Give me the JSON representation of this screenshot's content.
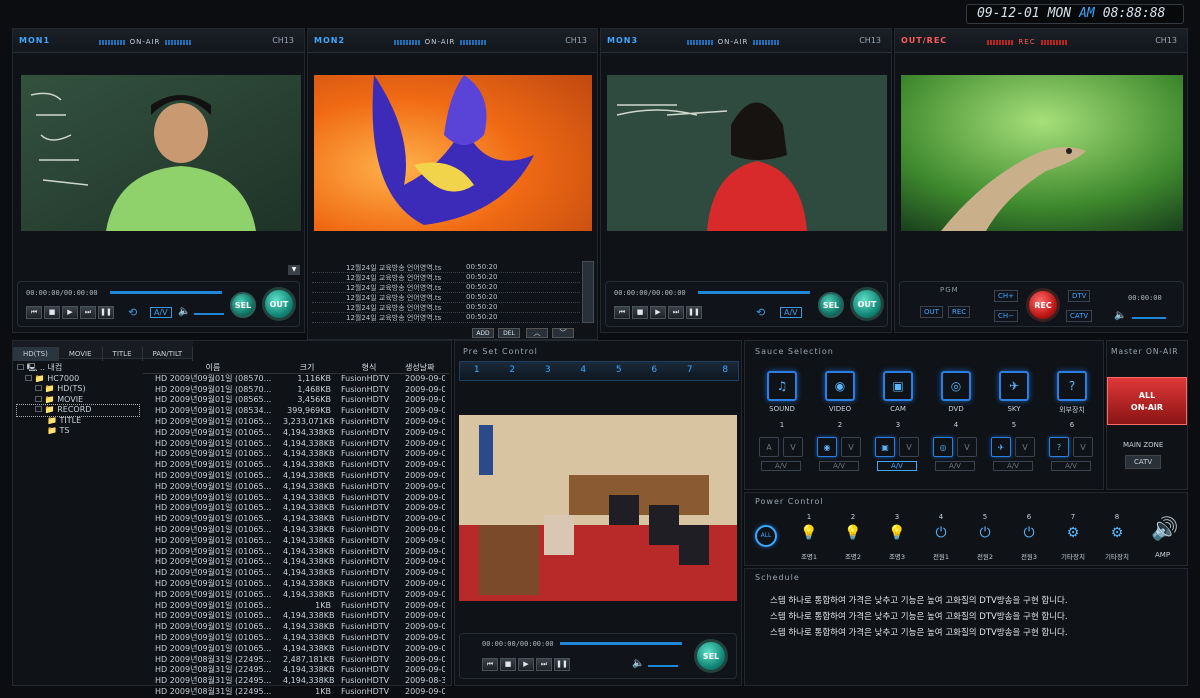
{
  "clock": {
    "date": "09-12-01",
    "day": "MON",
    "ampm": "AM",
    "time": "08:88:88"
  },
  "monitors": [
    {
      "name": "MON1",
      "status": "ON-AIR",
      "channel": "CH13",
      "timecode": "00:00:00/00:00:00",
      "name_color": "#3ea7ff"
    },
    {
      "name": "MON2",
      "status": "ON-AIR",
      "channel": "CH13",
      "name_color": "#3ea7ff"
    },
    {
      "name": "MON3",
      "status": "ON-AIR",
      "channel": "CH13",
      "timecode": "00:00:00/00:00:00",
      "name_color": "#3ea7ff"
    },
    {
      "name": "OUT/REC",
      "status": "REC",
      "channel": "CH13",
      "name_color": "#ff5a5a"
    }
  ],
  "playlist": {
    "items": [
      {
        "name": "12월24일 교육방송 언어영역.ts",
        "time": "00:50:20"
      },
      {
        "name": "12월24일 교육방송 언어영역.ts",
        "time": "00:50:20"
      },
      {
        "name": "12월24일 교육방송 언어영역.ts",
        "time": "00:50:20"
      },
      {
        "name": "12월24일 교육방송 언어영역.ts",
        "time": "00:50:20"
      },
      {
        "name": "12월24일 교육방송 언어영역.ts",
        "time": "00:50:20"
      },
      {
        "name": "12월24일 교육방송 언어영역.ts",
        "time": "00:50:20"
      }
    ],
    "add_label": "ADD",
    "del_label": "DEL"
  },
  "controls": {
    "av_label": "A/V",
    "sel_label": "SEL",
    "out_label": "OUT"
  },
  "outrec": {
    "pgm_label": "PGM",
    "out_label": "OUT",
    "rec_label": "REC",
    "chplus": "CH+",
    "chminus": "CH−",
    "dtv": "DTV",
    "catv": "CATV",
    "rec_btn": "REC",
    "timecode": "00:00:00"
  },
  "browser": {
    "tabs": [
      "HD(TS)",
      "MOVIE",
      "TITLE",
      "PAN/TILT"
    ],
    "tree": [
      "☐ 🖳 .. 내컴",
      "☐ 📁 HC7000",
      "☐ 📁 HD(TS)",
      "☐ 📁 MOVIE",
      "☐ 📁 RECORD",
      "📁 TITLE",
      "📁 TS"
    ],
    "columns": [
      "이름",
      "크기",
      "형식",
      "생성날짜"
    ],
    "rows": [
      [
        "HD 2009년09월01일 (08570...",
        "1,116KB",
        "FusionHDTV",
        "2009-09-01"
      ],
      [
        "HD 2009년09월01일 (08570...",
        "1,468KB",
        "FusionHDTV",
        "2009-09-01"
      ],
      [
        "HD 2009년09월01일 (08565...",
        "3,456KB",
        "FusionHDTV",
        "2009-09-01"
      ],
      [
        "HD 2009년09월01일 (08534...",
        "399,969KB",
        "FusionHDTV",
        "2009-09-01"
      ],
      [
        "HD 2009년09월01일 (01065...",
        "3,233,071KB",
        "FusionHDTV",
        "2009-09-01"
      ],
      [
        "HD 2009년09월01일 (01065...",
        "4,194,338KB",
        "FusionHDTV",
        "2009-09-01"
      ],
      [
        "HD 2009년09월01일 (01065...",
        "4,194,338KB",
        "FusionHDTV",
        "2009-09-01"
      ],
      [
        "HD 2009년09월01일 (01065...",
        "4,194,338KB",
        "FusionHDTV",
        "2009-09-01"
      ],
      [
        "HD 2009년09월01일 (01065...",
        "4,194,338KB",
        "FusionHDTV",
        "2009-09-01"
      ],
      [
        "HD 2009년09월01일 (01065...",
        "4,194,338KB",
        "FusionHDTV",
        "2009-09-01"
      ],
      [
        "HD 2009년09월01일 (01065...",
        "4,194,338KB",
        "FusionHDTV",
        "2009-09-01"
      ],
      [
        "HD 2009년09월01일 (01065...",
        "4,194,338KB",
        "FusionHDTV",
        "2009-09-01"
      ],
      [
        "HD 2009년09월01일 (01065...",
        "4,194,338KB",
        "FusionHDTV",
        "2009-09-01"
      ],
      [
        "HD 2009년09월01일 (01065...",
        "4,194,338KB",
        "FusionHDTV",
        "2009-09-01"
      ],
      [
        "HD 2009년09월01일 (01065...",
        "4,194,338KB",
        "FusionHDTV",
        "2009-09-01"
      ],
      [
        "HD 2009년09월01일 (01065...",
        "4,194,338KB",
        "FusionHDTV",
        "2009-09-01"
      ],
      [
        "HD 2009년09월01일 (01065...",
        "4,194,338KB",
        "FusionHDTV",
        "2009-09-01"
      ],
      [
        "HD 2009년09월01일 (01065...",
        "4,194,338KB",
        "FusionHDTV",
        "2009-09-01"
      ],
      [
        "HD 2009년09월01일 (01065...",
        "4,194,338KB",
        "FusionHDTV",
        "2009-09-01"
      ],
      [
        "HD 2009년09월01일 (01065...",
        "4,194,338KB",
        "FusionHDTV",
        "2009-09-01"
      ],
      [
        "HD 2009년09월01일 (01065...",
        "4,194,338KB",
        "FusionHDTV",
        "2009-09-01"
      ],
      [
        "HD 2009년09월01일 (01065...",
        "1KB",
        "FusionHDTV",
        "2009-09-01"
      ],
      [
        "HD 2009년09월01일 (01065...",
        "4,194,338KB",
        "FusionHDTV",
        "2009-09-01"
      ],
      [
        "HD 2009년09월01일 (01065...",
        "4,194,338KB",
        "FusionHDTV",
        "2009-09-01"
      ],
      [
        "HD 2009년09월01일 (01065...",
        "4,194,338KB",
        "FusionHDTV",
        "2009-09-01"
      ],
      [
        "HD 2009년09월01일 (01065...",
        "4,194,338KB",
        "FusionHDTV",
        "2009-09-01"
      ],
      [
        "HD 2009년08월31일 (22495...",
        "2,487,181KB",
        "FusionHDTV",
        "2009-09-01"
      ],
      [
        "HD 2009년08월31일 (22495...",
        "4,194,338KB",
        "FusionHDTV",
        "2009-09-01"
      ],
      [
        "HD 2009년08월31일 (22495...",
        "4,194,338KB",
        "FusionHDTV",
        "2009-08-31"
      ],
      [
        "HD 2009년08월31일 (22495...",
        "1KB",
        "FusionHDTV",
        "2009-09-01"
      ]
    ]
  },
  "preset": {
    "title": "Pre Set Control",
    "numbers": [
      "1",
      "2",
      "3",
      "4",
      "5",
      "6",
      "7",
      "8"
    ],
    "timecode": "00:00:00/00:00:00",
    "sel_label": "SEL"
  },
  "source": {
    "title": "Sauce Selection",
    "items": [
      {
        "label": "SOUND",
        "num": "1",
        "icon": "sound-icon"
      },
      {
        "label": "VIDEO",
        "num": "2",
        "icon": "video-icon"
      },
      {
        "label": "CAM",
        "num": "3",
        "icon": "cam-icon"
      },
      {
        "label": "DVD",
        "num": "4",
        "icon": "dvd-icon"
      },
      {
        "label": "SKY",
        "num": "5",
        "icon": "sky-icon"
      },
      {
        "label": "외부장치",
        "num": "6",
        "icon": "external-icon"
      }
    ],
    "mini_a": "A",
    "mini_v": "V",
    "av": "A/V"
  },
  "master": {
    "title": "Master ON-AIR",
    "all_onair_1": "ALL",
    "all_onair_2": "ON-AIR",
    "main_zone": "MAIN ZONE",
    "catv": "CATV"
  },
  "power": {
    "title": "Power Control",
    "all_label": "ALL",
    "items": [
      {
        "num": "1",
        "label": "조명1"
      },
      {
        "num": "2",
        "label": "조명2"
      },
      {
        "num": "3",
        "label": "조명3"
      },
      {
        "num": "4",
        "label": "전원1"
      },
      {
        "num": "5",
        "label": "전원2"
      },
      {
        "num": "6",
        "label": "전원3"
      },
      {
        "num": "7",
        "label": "기타장치"
      },
      {
        "num": "8",
        "label": "기타장치"
      }
    ],
    "amp_label": "AMP"
  },
  "schedule": {
    "title": "Schedule",
    "lines": [
      "스템 하나로 통합하여 가격은 낮추고 기능은 높여 고화질의 DTV방송을 구현 합니다.",
      "스템 하나로 통합하여 가격은 낮추고 기능은 높여 고화질의 DTV방송을 구현 합니다.",
      "스템 하나로 통합하여 가격은 낮추고 기능은 높여 고화질의 DTV방송을 구현 합니다."
    ]
  }
}
